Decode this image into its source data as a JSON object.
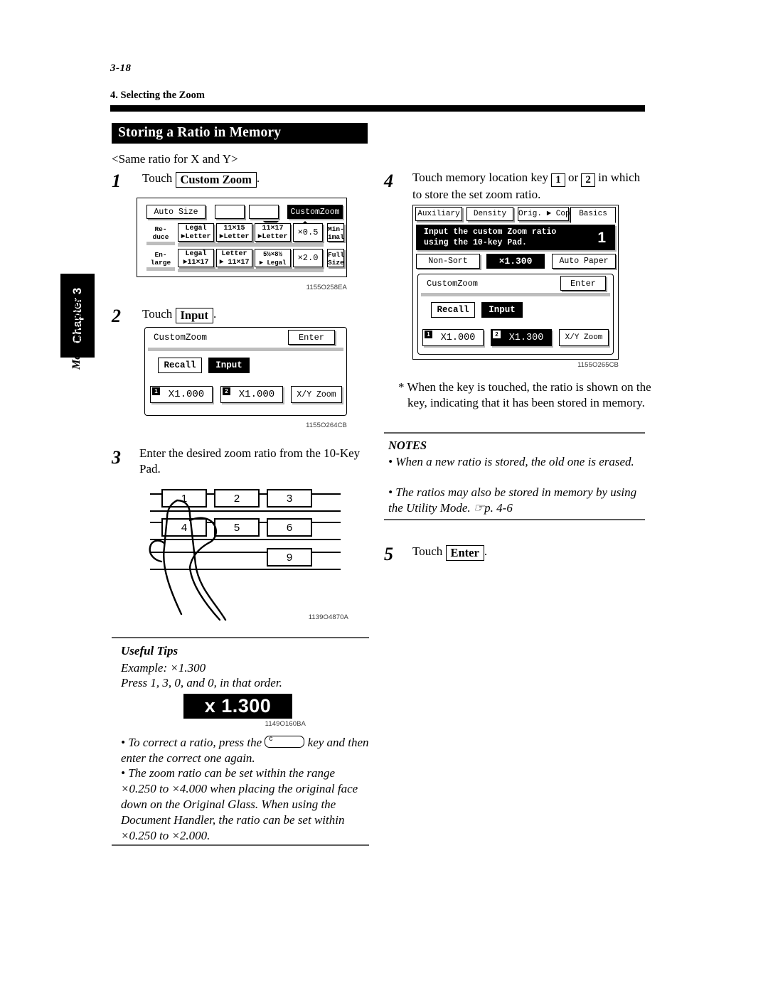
{
  "page": {
    "folio": "3-18",
    "running_head": "4. Selecting the Zoom",
    "section_title": "Storing a Ratio in Memory",
    "side_tab": {
      "chapter": "Chapter 3",
      "label": "Making Copies"
    }
  },
  "left_column": {
    "subhead": "<Same ratio for X and Y>",
    "steps": [
      {
        "num": "1",
        "before": "Touch",
        "key": "Custom Zoom",
        "after": "."
      },
      {
        "num": "2",
        "before": "Touch",
        "key": "Input",
        "after": "."
      },
      {
        "num": "3",
        "text": "Enter the desired zoom ratio from the 10-Key Pad."
      }
    ],
    "figure1": {
      "caption": "1155O258EA",
      "top_row": [
        "Auto Size",
        "reduce-arrow-icon",
        "enlarge-arrow-icon",
        "CustomZoom"
      ],
      "reduce_label": "Re-\nduce",
      "reduce_keys": [
        "Legal\n►Letter",
        "11×15\n►Letter",
        "11×17\n►Letter",
        "×0.5"
      ],
      "reduce_end": "Min-\nimal",
      "enlarge_label": "En-\nlarge",
      "enlarge_keys": [
        "Legal\n►11×17",
        "Letter\n► 11×17",
        "5½×8½\n► Legal",
        "×2.0"
      ],
      "enlarge_end": "Full\nSize"
    },
    "figure2": {
      "caption": "1155O264CB",
      "title": "CustomZoom",
      "enter": "Enter",
      "recall": "Recall",
      "input": "Input",
      "mem1_badge": "1",
      "mem1": "X1.000",
      "mem2_badge": "2",
      "mem2": "X1.000",
      "xy": "X/Y Zoom"
    },
    "keypad": {
      "caption": "1139O4870A",
      "keys": [
        "1",
        "2",
        "3",
        "4",
        "5",
        "6",
        "9"
      ]
    },
    "tips": {
      "heading": "Useful Tips",
      "example": "Example: ×1.300",
      "press": "Press 1, 3, 0, and 0, in that order.",
      "ratio_display": "x 1.300",
      "ratio_caption": "1149O160BA",
      "bullets": [
        {
          "part1": "To correct a ratio, press the",
          "key": "c",
          "part2": "key and then enter the correct one again."
        },
        {
          "text": "The zoom ratio can be set within the range ×0.250 to ×4.000 when placing the original face down on the Original Glass. When using the Document Handler, the ratio can be set within ×0.250 to ×2.000."
        }
      ]
    }
  },
  "right_column": {
    "step4": {
      "num": "4",
      "line1_before": "Touch memory location key",
      "key1": "1",
      "mid": "or",
      "key2": "2",
      "line1_after": "in",
      "line2": "which to store the set zoom ratio."
    },
    "figure3": {
      "caption": "1155O265CB",
      "tabs": [
        "Auxiliary",
        "Density",
        "Orig. ► Copy",
        "Basics"
      ],
      "message_line1": "Input the custom Zoom ratio",
      "message_line2": "using the 10-key Pad.",
      "copy_count": "1",
      "sort": "Non-Sort",
      "ratio": "×1.300",
      "paper": "Auto Paper",
      "title": "CustomZoom",
      "enter": "Enter",
      "recall": "Recall",
      "input": "Input",
      "mem1_badge": "1",
      "mem1": "X1.000",
      "mem2_badge": "2",
      "mem2": "X1.300",
      "xy": "X/Y Zoom"
    },
    "footnote": "* When the key is touched, the ratio is shown on the key, indicating that it has been stored in memory.",
    "notes": {
      "heading": "NOTES",
      "items": [
        "When a new ratio is stored, the old one is erased.",
        "The ratios may also be stored in memory by using the Utility Mode. ☞p. 4-6"
      ]
    },
    "step5": {
      "num": "5",
      "before": "Touch",
      "key": "Enter",
      "after": "."
    }
  }
}
